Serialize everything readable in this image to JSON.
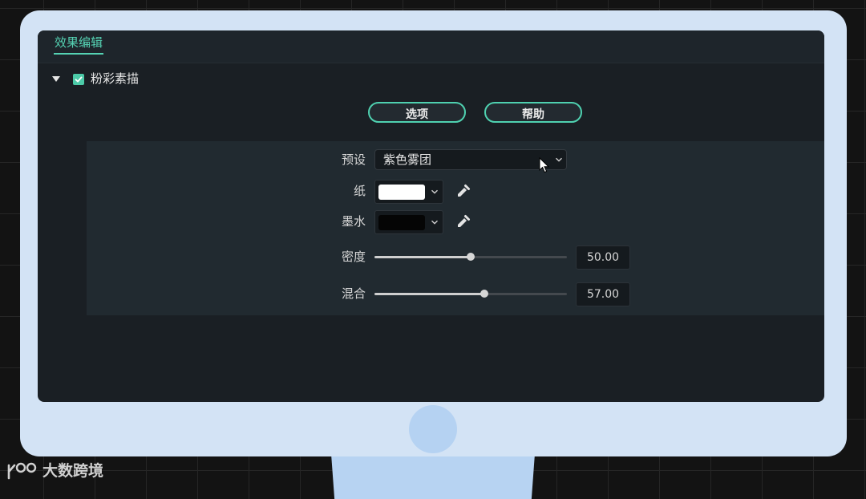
{
  "panel": {
    "tab_label": "效果编辑",
    "effect_name": "粉彩素描",
    "effect_enabled": true,
    "options_button": "选项",
    "help_button": "帮助"
  },
  "params": {
    "preset": {
      "label": "预设",
      "value": "紫色雾团"
    },
    "paper": {
      "label": "纸",
      "color": "#ffffff"
    },
    "ink": {
      "label": "墨水",
      "color": "#050505"
    },
    "density": {
      "label": "密度",
      "value": "50.00",
      "fraction": 0.5
    },
    "blend": {
      "label": "混合",
      "value": "57.00",
      "fraction": 0.57
    }
  },
  "watermark": {
    "text": "大数跨境"
  },
  "colors": {
    "accent": "#4fd1b0",
    "screen_bg": "#1a1f24",
    "monitor_frame": "#d3e3f5"
  }
}
